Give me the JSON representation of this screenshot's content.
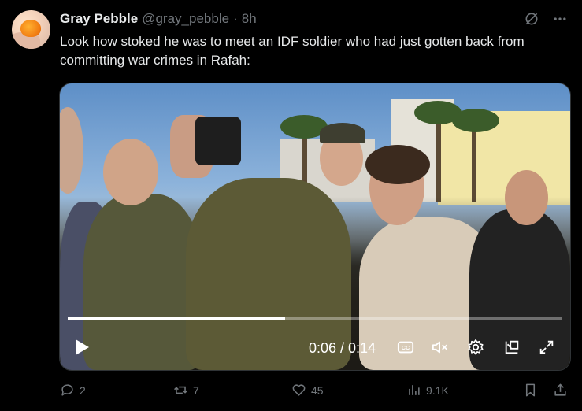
{
  "tweet": {
    "author_name": "Gray Pebble",
    "author_handle": "@gray_pebble",
    "separator": "·",
    "time": "8h",
    "text": "Look how stoked he was to meet an IDF soldier who had just gotten back from committing war crimes in Rafah:"
  },
  "video": {
    "timecode": "0:06 / 0:14",
    "cc_label": "CC",
    "progress": 0.44
  },
  "actions": {
    "replies": "2",
    "reposts": "7",
    "likes": "45",
    "views": "9.1K"
  },
  "colors": {
    "background": "#000000",
    "text": "#e7e9ea",
    "muted": "#71767b"
  }
}
